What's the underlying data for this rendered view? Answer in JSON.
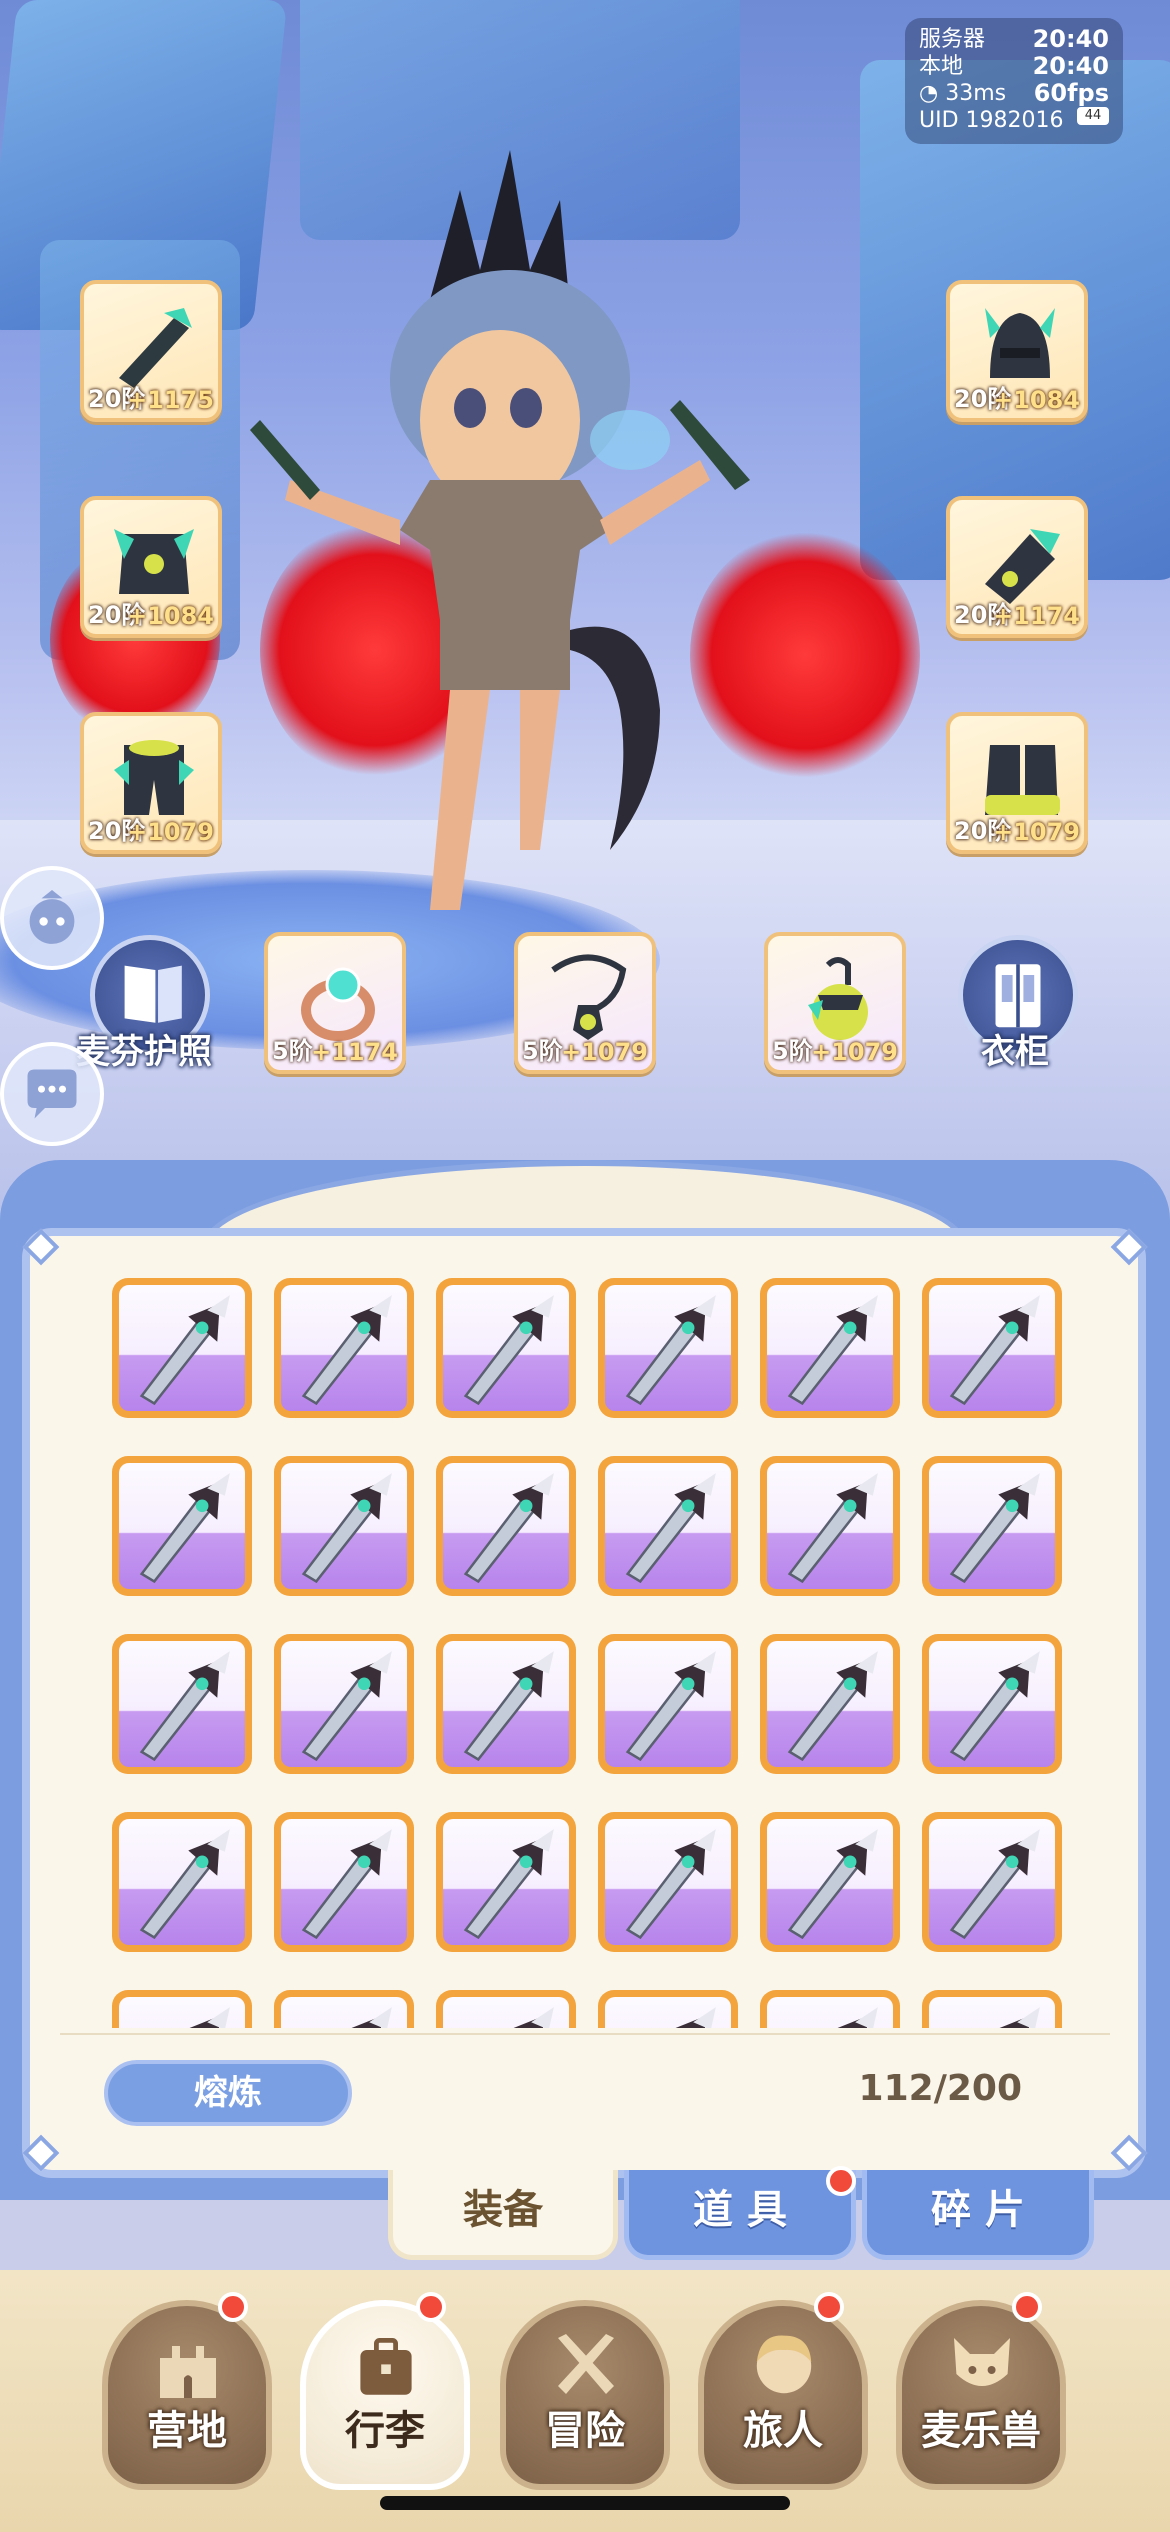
{
  "status": {
    "server_label": "服务器",
    "server_time": "20:40",
    "local_label": "本地",
    "local_time": "20:40",
    "ping": "33ms",
    "fps": "60fps",
    "uid": "UID 1982016",
    "battery": "44"
  },
  "equipment_slots": [
    {
      "tier": "20阶",
      "bonus": "+1175"
    },
    {
      "tier": "20阶",
      "bonus": "+1084"
    },
    {
      "tier": "20阶",
      "bonus": "+1084"
    },
    {
      "tier": "20阶",
      "bonus": "+1174"
    },
    {
      "tier": "20阶",
      "bonus": "+1079"
    },
    {
      "tier": "20阶",
      "bonus": "+1079"
    }
  ],
  "accessory_slots": [
    {
      "tier": "5阶",
      "bonus": "+1174"
    },
    {
      "tier": "5阶",
      "bonus": "+1079"
    },
    {
      "tier": "5阶",
      "bonus": "+1079"
    }
  ],
  "buttons": {
    "passport": "麦芬护照",
    "wardrobe": "衣柜"
  },
  "inventory": {
    "smelt_label": "熔炼",
    "capacity": "112/200",
    "visible_rows": 5,
    "columns": 6
  },
  "tabs": [
    {
      "label": "装备",
      "active": true,
      "badge": false
    },
    {
      "label": "道 具",
      "active": false,
      "badge": true
    },
    {
      "label": "碎 片",
      "active": false,
      "badge": false
    }
  ],
  "nav": [
    {
      "label": "营地",
      "icon": "castle-icon",
      "badge": true,
      "active": false
    },
    {
      "label": "行李",
      "icon": "luggage-icon",
      "badge": true,
      "active": true
    },
    {
      "label": "冒险",
      "icon": "crossed-swords-icon",
      "badge": false,
      "active": false
    },
    {
      "label": "旅人",
      "icon": "traveler-icon",
      "badge": true,
      "active": false
    },
    {
      "label": "麦乐兽",
      "icon": "pet-icon",
      "badge": true,
      "active": false
    }
  ],
  "colors": {
    "panel_blue": "#7c9de0",
    "item_frame": "#f3a43d",
    "badge_red": "#f24a3a"
  }
}
